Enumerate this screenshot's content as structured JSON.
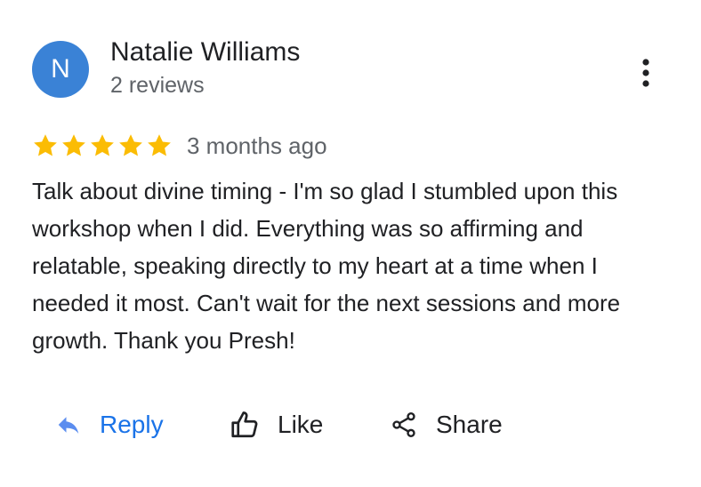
{
  "author": {
    "initial": "N",
    "name": "Natalie Williams",
    "reviews": "2 reviews",
    "avatar_color": "#3a82d6"
  },
  "review": {
    "rating": 5,
    "max_rating": 5,
    "star_color": "#fbbc04",
    "age": "3 months ago",
    "text": "Talk about divine timing - I'm so glad I stumbled upon this workshop when I did. Everything was so affirming and relatable, speaking directly to my heart at a time when I needed it most. Can't wait for the next sessions and more growth. Thank you Presh!"
  },
  "actions": {
    "reply": {
      "label": "Reply",
      "icon": "reply-arrow-icon",
      "color": "#1a73e8"
    },
    "like": {
      "label": "Like",
      "icon": "thumbs-up-icon"
    },
    "share": {
      "label": "Share",
      "icon": "share-icon"
    }
  },
  "menu": {
    "icon": "more-vertical-icon"
  }
}
